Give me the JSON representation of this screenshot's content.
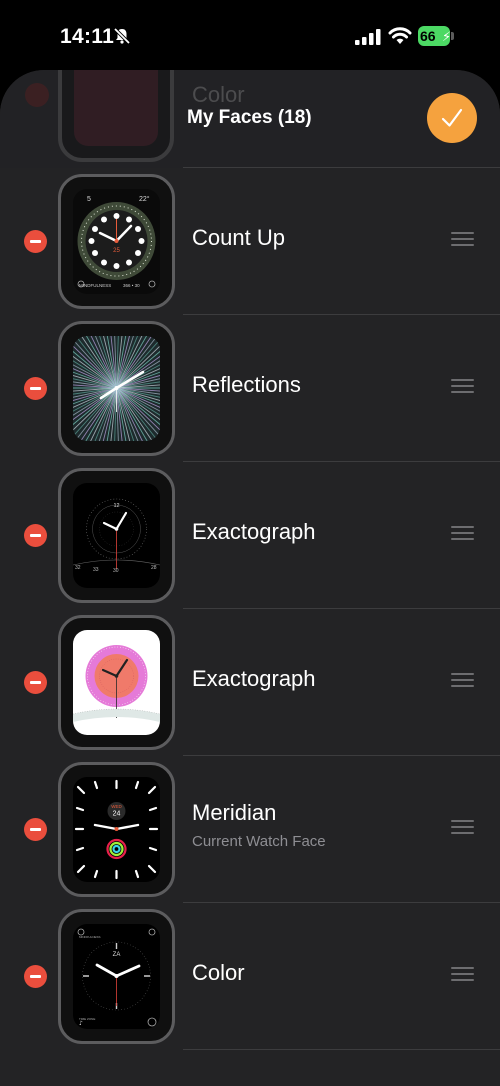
{
  "status_bar": {
    "time": "14:11",
    "battery": "66"
  },
  "header": {
    "title": "My Faces (18)",
    "ghost_label": "Color"
  },
  "faces": [
    {
      "name": "Count Up",
      "subtitle": "",
      "complications": [
        "5",
        "22°",
        "25",
        "MINDFULNESS",
        "366 • 30"
      ]
    },
    {
      "name": "Reflections",
      "subtitle": ""
    },
    {
      "name": "Exactograph",
      "subtitle": "",
      "complications": [
        "12",
        "32",
        "33",
        "30",
        "28"
      ]
    },
    {
      "name": "Exactograph",
      "subtitle": ""
    },
    {
      "name": "Meridian",
      "subtitle": "Current Watch Face",
      "complications": [
        "WED",
        "24"
      ]
    },
    {
      "name": "Color",
      "subtitle": "",
      "complications": [
        "ZA",
        "MINDFULNESS",
        "TIME ZONE"
      ]
    }
  ],
  "colors": {
    "accent": "#f5a23e",
    "delete": "#ea4e3d",
    "sheet": "#232325",
    "battery": "#4cd964"
  },
  "icons": [
    "bell-slash-icon",
    "cellular-signal-icon",
    "wifi-icon",
    "battery-icon",
    "checkmark-icon",
    "minus-circle-icon",
    "drag-handle-icon"
  ]
}
